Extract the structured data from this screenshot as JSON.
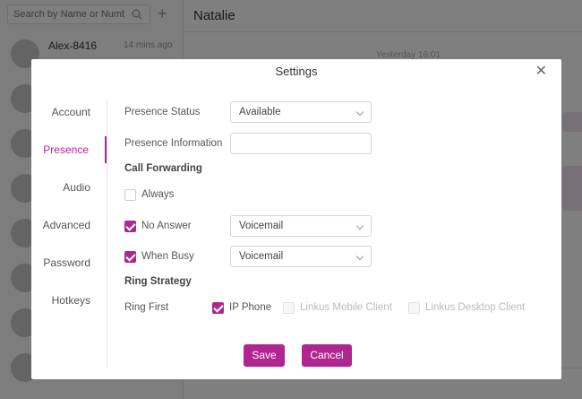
{
  "background": {
    "search_placeholder": "Search by Name or Number",
    "contact": {
      "name": "Alex-8416",
      "time": "14 mins ago"
    },
    "chat_title": "Natalie",
    "yesterday_label": "Yesterday 16:01"
  },
  "modal": {
    "title": "Settings",
    "tabs": [
      "Account",
      "Presence",
      "Audio",
      "Advanced",
      "Password",
      "Hotkeys"
    ],
    "active_tab": "Presence",
    "presence_status": {
      "label": "Presence Status",
      "value": "Available"
    },
    "presence_information": {
      "label": "Presence Information",
      "value": ""
    },
    "call_forwarding": {
      "heading": "Call Forwarding",
      "always": {
        "label": "Always",
        "checked": false
      },
      "no_answer": {
        "label": "No Answer",
        "checked": true,
        "value": "Voicemail"
      },
      "when_busy": {
        "label": "When Busy",
        "checked": true,
        "value": "Voicemail"
      }
    },
    "ring_strategy": {
      "heading": "Ring Strategy",
      "ring_first_label": "Ring First",
      "ip_phone": {
        "label": "IP Phone",
        "checked": true
      },
      "mobile": {
        "label": "Linkus Mobile Client",
        "checked": false,
        "disabled": true
      },
      "desktop": {
        "label": "Linkus Desktop Client",
        "checked": false,
        "disabled": true
      }
    },
    "save_label": "Save",
    "cancel_label": "Cancel"
  },
  "colors": {
    "accent": "#b0258f",
    "overlay": "rgba(0,0,0,0.5)"
  }
}
